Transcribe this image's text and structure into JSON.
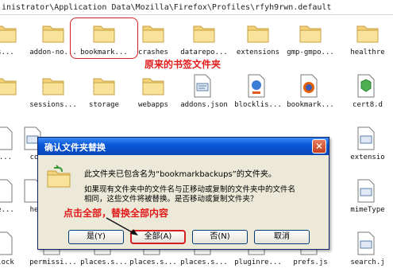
{
  "address_bar": {
    "path": "inistrator\\Application Data\\Mozilla\\Firefox\\Profiles\\rfyh9rwn.default"
  },
  "grid": {
    "row1": [
      "s...",
      "addon-no...",
      "bookmark...",
      "crashes",
      "datarepo...",
      "extensions",
      "gmp-gmpo...",
      "healthre"
    ],
    "row2": [
      "",
      "sessions...",
      "storage",
      "webapps",
      "addons.json",
      "blocklis...",
      "bookmark...",
      "cert8.d"
    ],
    "row3": [
      "...",
      "co",
      "",
      "",
      "",
      "",
      "",
      "extensio"
    ],
    "row4": [
      "e...",
      "he",
      "",
      "",
      "",
      "",
      "",
      "mimeType"
    ],
    "row5": [
      "lock",
      "permissi...",
      "places.s...",
      "places.s...",
      "places.s...",
      "pluginre...",
      "prefs.js",
      "search.j"
    ]
  },
  "annotations": {
    "folder_note": "原来的书签文件夹",
    "click_note": "点击全部，替换全部内容"
  },
  "dialog": {
    "title": "确认文件夹替换",
    "close_glyph": "✕",
    "line1": "此文件夹已包含名为“bookmarkbackups”的文件夹。",
    "line2": "如果现有文件夹中的文件名与正移动或复制的文件夹中的文件名",
    "line3": "相同，这些文件将被替换。是否移动或复制文件夹？",
    "buttons": {
      "yes": "是(Y)",
      "all": "全部(A)",
      "no": "否(N)",
      "cancel": "取消"
    }
  },
  "colors": {
    "accent_red": "#e21a1a",
    "title_blue": "#0a58d8",
    "dialog_bg": "#ece9d8"
  }
}
